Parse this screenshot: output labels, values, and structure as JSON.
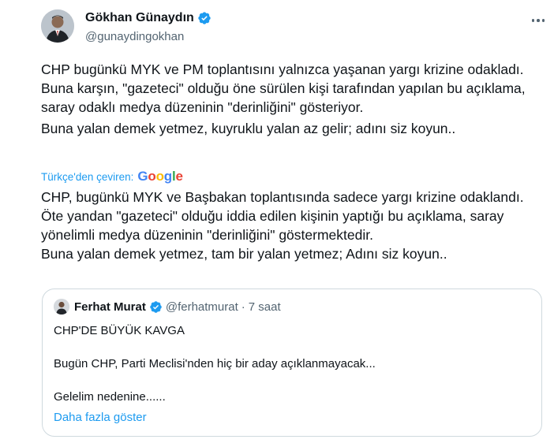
{
  "author": {
    "name": "Gökhan Günaydın",
    "handle": "@gunaydingokhan",
    "verified_color": "#1d9bf0"
  },
  "tweet": {
    "lines": [
      "CHP bugünkü MYK ve PM toplantısını yalnızca yaşanan yargı krizine odakladı.",
      "Buna karşın, \"gazeteci\" olduğu öne sürülen kişi tarafından yapılan bu açıklama, saray odaklı medya düzeninin \"derinliğini\" gösteriyor.",
      "Buna yalan demek yetmez, kuyruklu yalan az gelir; adını siz koyun.."
    ]
  },
  "translation": {
    "label": "Türkçe'den çeviren:",
    "provider": "Google",
    "lines": [
      "CHP, bugünkü MYK ve Başbakan toplantısında sadece yargı krizine odaklandı.",
      "Öte yandan \"gazeteci\" olduğu iddia edilen kişinin yaptığı bu açıklama, saray yönelimli medya düzeninin \"derinliğini\" göstermektedir.",
      "Buna yalan demek yetmez, tam bir yalan yetmez; Adını siz koyun.."
    ]
  },
  "quote": {
    "name": "Ferhat Murat",
    "handle": "@ferhatmurat",
    "separator": "·",
    "time": "7 saat",
    "lines": [
      "CHP'DE BÜYÜK KAVGA",
      "",
      "Bugün CHP, Parti Meclisi'nden hiç bir aday açıklanmayacak...",
      "",
      "Gelelim nedenine......"
    ],
    "show_more": "Daha fazla göster"
  },
  "icons": {
    "more": "more-horizontal-icon",
    "verified": "verified-badge-icon"
  }
}
